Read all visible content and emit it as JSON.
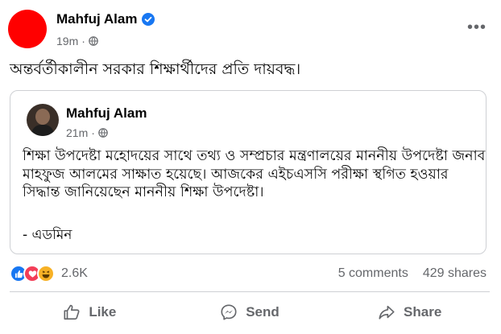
{
  "post": {
    "author": "Mahfuj Alam",
    "time": "19m",
    "text": "অন্তর্বর্তীকালীন সরকার শিক্ষার্থীদের প্রতি দায়বদ্ধ।"
  },
  "shared": {
    "author": "Mahfuj Alam",
    "time": "21m",
    "body": "শিক্ষা উপদেষ্টা মহোদয়ের সাথে তথ্য ও সম্প্রচার মন্ত্রণালয়ের মাননীয় উপদেষ্টা জনাব মাহফুজ আলমের সাক্ষাত হয়েছে। আজকের এইচএসসি পরীক্ষা স্থগিত হওয়ার সিদ্ধান্ত জানিয়েছেন মাননীয় শিক্ষা উপদেষ্টা।",
    "signature": "- এডমিন"
  },
  "engagement": {
    "reactions_count": "2.6K",
    "comments": "5 comments",
    "shares": "429 shares"
  },
  "actions": {
    "like": "Like",
    "send": "Send",
    "share": "Share"
  },
  "colors": {
    "accent": "#1877f2",
    "secondary_text": "#65676b",
    "avatar_main": "#ff0000"
  },
  "icons": [
    "verified-badge-icon",
    "globe-icon",
    "more-options-icon",
    "like-reaction-icon",
    "love-reaction-icon",
    "haha-reaction-icon",
    "thumbs-up-icon",
    "messenger-icon",
    "share-arrow-icon"
  ]
}
